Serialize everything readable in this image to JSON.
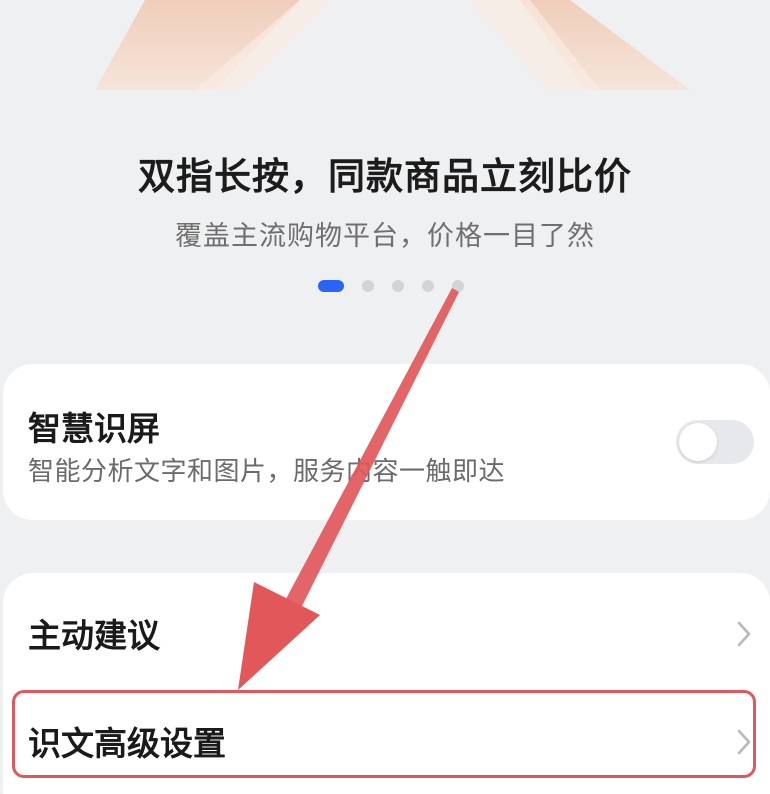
{
  "intro": {
    "headline": "双指长按，同款商品立刻比价",
    "subline": "覆盖主流购物平台，价格一目了然",
    "pager": {
      "count": 5,
      "active_index": 0
    }
  },
  "smart_screen": {
    "title": "智慧识屏",
    "description": "智能分析文字和图片，服务内容一触即达",
    "enabled": false
  },
  "settings": {
    "items": [
      {
        "label": "主动建议",
        "value": ""
      },
      {
        "label": "识文高级设置",
        "value": ""
      }
    ]
  },
  "colors": {
    "accent": "#2a64f6",
    "annotation": "#e2585a",
    "background": "#eff0f2",
    "card": "#ffffff"
  },
  "icons": [
    "chevron-right-icon",
    "annotation-arrow-icon"
  ]
}
